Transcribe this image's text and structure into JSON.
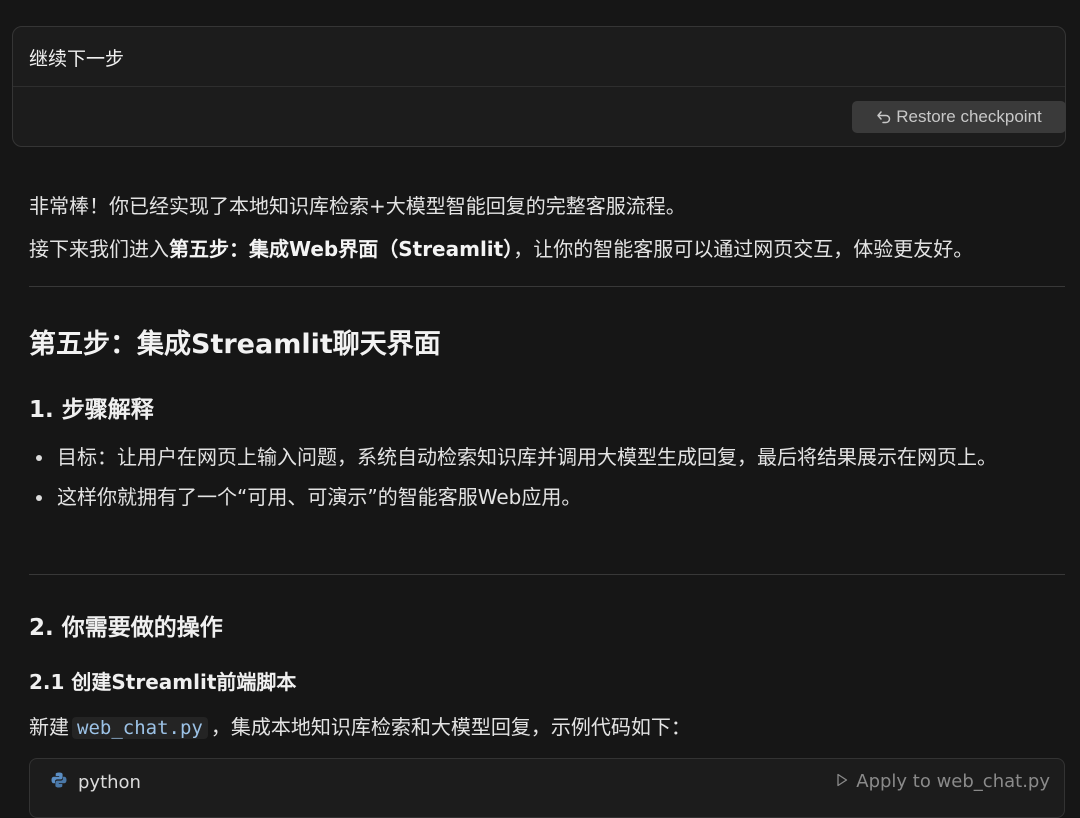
{
  "user_message": {
    "text": "继续下一步",
    "restore_label": "Restore checkpoint"
  },
  "reply": {
    "intro_line": "非常棒！你已经实现了本地知识库检索+大模型智能回复的完整客服流程。",
    "next_prefix": "接下来我们进入",
    "next_bold": "第五步：集成Web界面（Streamlit）",
    "next_suffix": "，让你的智能客服可以通过网页交互，体验更友好。",
    "section_title": "第五步：集成Streamlit聊天界面",
    "step1_heading": "1. 步骤解释",
    "bullets": [
      "目标：让用户在网页上输入问题，系统自动检索知识库并调用大模型生成回复，最后将结果展示在网页上。",
      "这样你就拥有了一个“可用、可演示”的智能客服Web应用。"
    ],
    "step2_heading": "2. 你需要做的操作",
    "step21_heading": "2.1 创建Streamlit前端脚本",
    "create_prefix": "新建",
    "create_filename": "web_chat.py",
    "create_suffix": "，集成本地知识库检索和大模型回复，示例代码如下："
  },
  "code_block": {
    "language": "python",
    "apply_label": "Apply to web_chat.py",
    "icon": "python-icon"
  },
  "colors": {
    "background": "#161616",
    "card": "#1c1c1c",
    "inline_code": "#9cc2e6"
  }
}
